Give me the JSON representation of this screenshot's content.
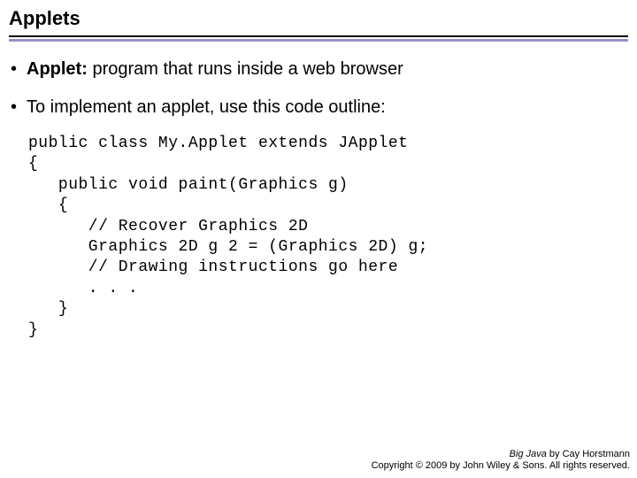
{
  "title": "Applets",
  "bullets": {
    "b1_term": "Applet:",
    "b1_rest": " program that runs inside a web browser",
    "b2": "To implement an applet, use this code outline:"
  },
  "code": "public class My.Applet extends JApplet\n{\n   public void paint(Graphics g)\n   {\n      // Recover Graphics 2D\n      Graphics 2D g 2 = (Graphics 2D) g;\n      // Drawing instructions go here\n      . . .\n   }\n}",
  "footer": {
    "book": "Big Java",
    "author": " by Cay Horstmann",
    "copyright": "Copyright © 2009 by John Wiley & Sons. All rights reserved."
  }
}
